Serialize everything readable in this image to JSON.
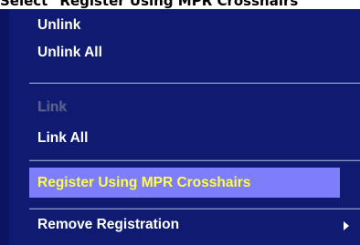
{
  "caption": "Select \"Register Using MPR Crosshairs\"",
  "menu": {
    "items": [
      {
        "label": "Unlink",
        "enabled": true
      },
      {
        "label": "Unlink All",
        "enabled": true
      },
      {
        "label": "Link",
        "enabled": false
      },
      {
        "label": "Link All",
        "enabled": true
      },
      {
        "label": "Register Using MPR Crosshairs",
        "enabled": true,
        "highlighted": true
      },
      {
        "label": "Remove Registration",
        "enabled": true,
        "has_submenu": true,
        "submenu_icon": "chevron-right-icon"
      }
    ],
    "colors": {
      "background": "#0f1b70",
      "text": "#ffffff",
      "highlight_background": "#7e7dfa",
      "highlight_text": "#ffff44",
      "disabled_text": "#5a6190"
    }
  }
}
